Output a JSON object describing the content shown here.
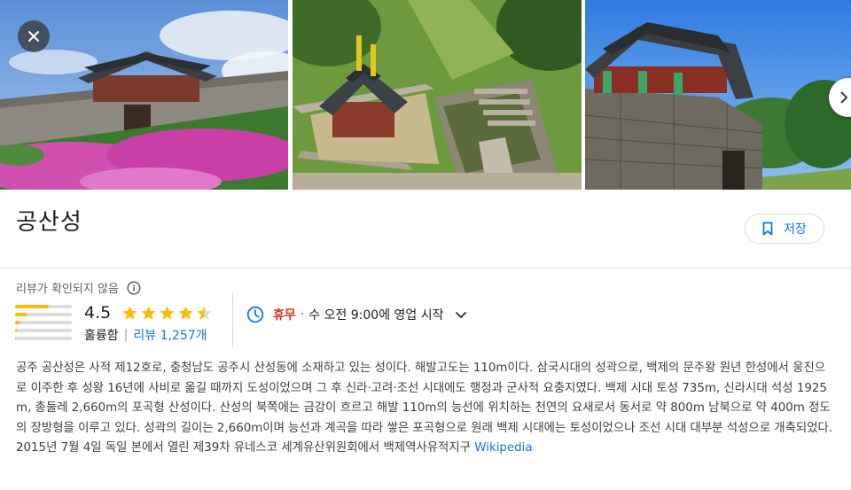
{
  "place": {
    "title": "공산성",
    "save_label": "저장"
  },
  "review_notice": "리뷰가 확인되지 않음",
  "rating": {
    "value": "4.5",
    "stars": 4.5,
    "word": "훌륭함",
    "separator": "|",
    "reviews_label": "리뷰 1,257개",
    "distribution": [
      0.6,
      0.2,
      0.08,
      0.03,
      0.02
    ]
  },
  "hours": {
    "status": "휴무",
    "dot": "·",
    "detail": "수 오전 9:00에 영업 시작"
  },
  "description": {
    "text": "공주 공산성은 사적 제12호로, 충청남도 공주시 산성동에 소재하고 있는 성이다. 해발고도는 110m이다. 삼국시대의 성곽으로, 백제의 문주왕 원년 한성에서 웅진으로 이주한 후 성왕 16년에 사비로 옮길 때까지 도성이었으며 그 후 신라·고려·조선 시대에도 행정과 군사적 요충지였다. 백제 시대 토성 735m, 신라시대 석성 1925m, 총둘레 2,660m의 포곡형 산성이다. 산성의 북쪽에는 금강이 흐르고 해발 110m의 능선에 위치하는 천연의 요새로서 동서로 약 800m 남북으로 약 400m 정도의 장방형을 이루고 있다. 성곽의 길이는 2,660m이며 능선과 계곡을 따라 쌓은 포곡형으로 원래 백제 시대에는 토성이었으나 조선 시대 대부분 석성으로 개축되었다. 2015년 7월 4일 독일 본에서 열린 제39차 유네스코 세계유산위원회에서 백제역사유적지구",
    "source_link": "Wikipedia"
  },
  "icons": {
    "close": "close-icon",
    "next": "chevron-right-icon",
    "save": "bookmark-icon",
    "info": "info-icon",
    "clock": "clock-icon",
    "expand": "chevron-down-icon"
  },
  "colors": {
    "accent": "#1a73e8",
    "star": "#fbbc04",
    "closed": "#d93025"
  }
}
